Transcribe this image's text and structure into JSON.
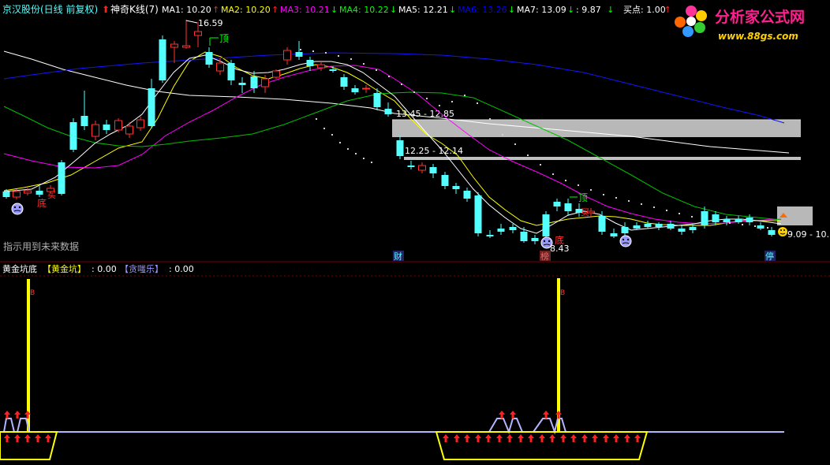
{
  "main_legend": {
    "stock": "京汉股份",
    "period": "(日线 前复权)",
    "indicator": "神奇K线(7)",
    "items": [
      {
        "label": "MA1: 10.20",
        "color": "#ffffff",
        "arrow": "up"
      },
      {
        "label": "MA2: 10.20",
        "color": "#ffff00",
        "arrow": "up"
      },
      {
        "label": "MA3: 10.21",
        "color": "#ff00ff",
        "arrow": "down"
      },
      {
        "label": "MA4: 10.22",
        "color": "#00ff00",
        "arrow": "down"
      },
      {
        "label": "MA5: 12.21",
        "color": "#ffffff",
        "arrow": "down"
      },
      {
        "label": "MA6: 13.26",
        "color": "#0000ff",
        "arrow": "down"
      },
      {
        "label": "MA7: 13.09",
        "color": "#ffffff",
        "arrow": "down"
      },
      {
        "label": ": 9.87",
        "color": "#ffffff",
        "arrow": "down"
      },
      {
        "label": "买点: 1.00",
        "color": "#ffffff",
        "arrow": "up"
      }
    ]
  },
  "watermark": {
    "title": "分析家公式网",
    "url": "www.88gs.com"
  },
  "annotations": {
    "high": "16.59",
    "low": "8.43",
    "top1": "顶",
    "top2": "顶",
    "bottom1": "底",
    "bottom2": "底",
    "buy_label": "买",
    "zone1": "13.45 - 12.85",
    "zone2": "12.25 - 12.14",
    "zone3": "9.09 - 10.",
    "future_note": "指示用到未来数据",
    "cai": "财",
    "bang": "榜",
    "ting": "停"
  },
  "sub_legend": {
    "name": "黄金坑底",
    "s1": "【黄金坑】",
    "v1": ": 0.00",
    "s2": "【贪嗤乐】",
    "v2": ": 0.00",
    "marker": "B"
  },
  "colors": {
    "up": "#ff3232",
    "down": "#54ffff",
    "ma_white": "#ffffff",
    "ma_yellow": "#ffff00",
    "ma_magenta": "#ff00ff",
    "ma_green": "#00c000",
    "ma_blue": "#0000ff",
    "grid": "#800000",
    "zone": "#bbbbbb",
    "arrow": "#ff2020",
    "baseline": "#b4b4ff"
  }
}
